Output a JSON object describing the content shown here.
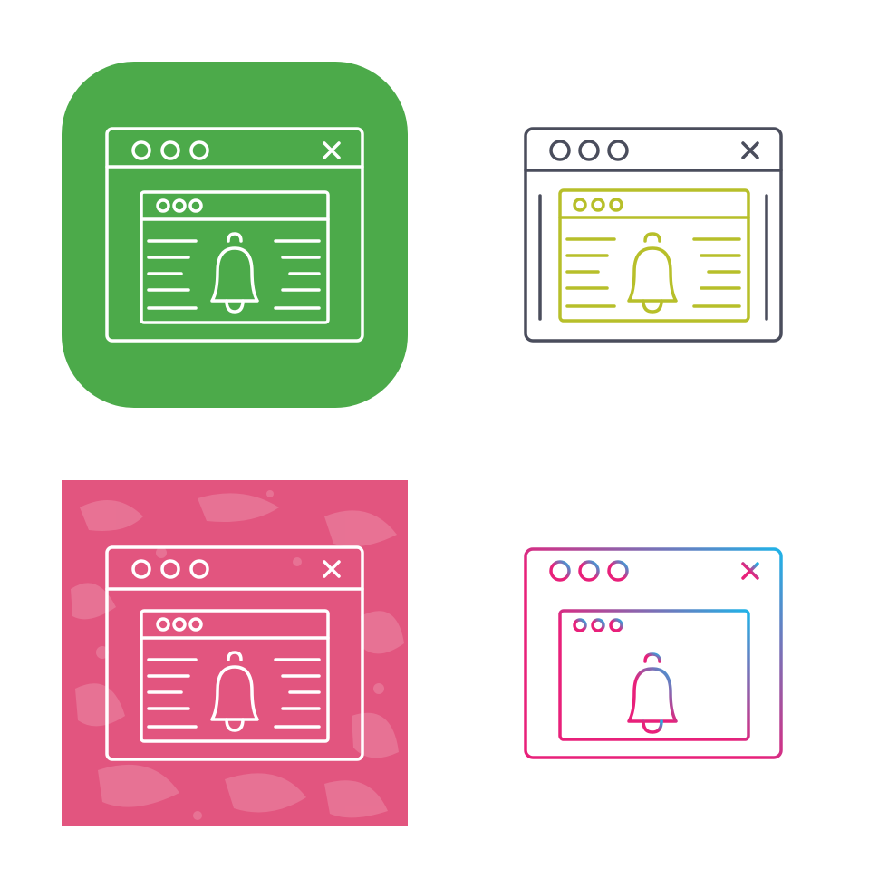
{
  "icon_set": {
    "subject": "browser-window-notification-bell",
    "variants": [
      {
        "name": "green-rounded-background",
        "style": "line-on-glyph",
        "background": "#4caa4a",
        "stroke": "#ffffff"
      },
      {
        "name": "two-tone-outline",
        "style": "line",
        "frame_stroke": "#4a4d5c",
        "content_stroke": "#b7bf2a"
      },
      {
        "name": "pink-textured-background",
        "style": "line-on-glyph",
        "background": "#e2557f",
        "texture": "#ec8aa6",
        "stroke": "#ffffff"
      },
      {
        "name": "gradient-outline",
        "style": "gradient-line",
        "gradient_start": "#e8207a",
        "gradient_end": "#1fb3e8"
      }
    ]
  }
}
